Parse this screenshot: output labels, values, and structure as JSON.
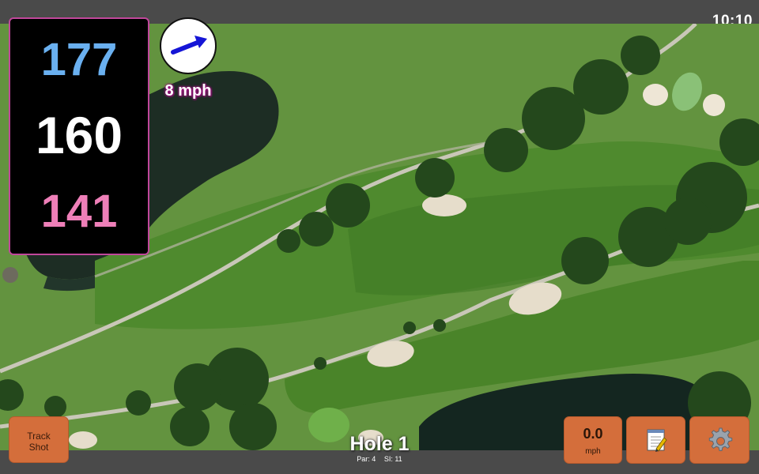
{
  "clock": "10:10",
  "yardages": {
    "back": "177",
    "center": "160",
    "front": "141"
  },
  "wind": {
    "speed_text": "8 mph",
    "icon": "wind-direction-arrow-icon",
    "direction": "east-northeast"
  },
  "buttons": {
    "track_shot_line1": "Track",
    "track_shot_line2": "Shot",
    "speed_value": "0.0",
    "speed_unit": "mph",
    "notes_icon": "notepad-icon",
    "settings_icon": "gear-icon"
  },
  "hole": {
    "title": "Hole 1",
    "par": "Par: 4",
    "si": "SI: 11"
  },
  "colors": {
    "back": "#6ab0f0",
    "center": "#ffffff",
    "front": "#ee7fb8",
    "panel_border": "#c0479b",
    "button": "#d46e3b"
  }
}
